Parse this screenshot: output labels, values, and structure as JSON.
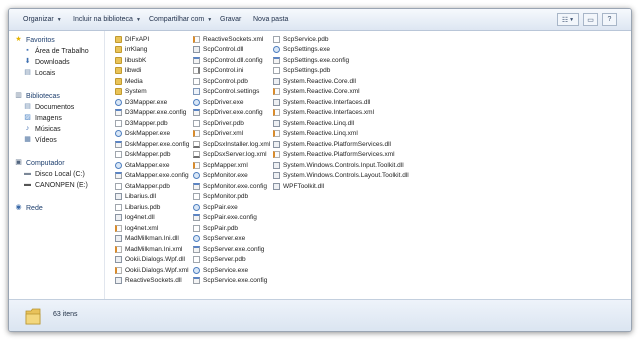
{
  "toolbar": {
    "organize": "Organizar",
    "include": "Incluir na biblioteca",
    "share": "Compartilhar com",
    "burn": "Gravar",
    "new_folder": "Nova pasta"
  },
  "nav": {
    "favorites": "Favoritos",
    "desktop": "Área de Trabalho",
    "downloads": "Downloads",
    "places": "Locais",
    "libraries": "Bibliotecas",
    "documents": "Documentos",
    "pictures": "Imagens",
    "music": "Músicas",
    "videos": "Vídeos",
    "computer": "Computador",
    "local_disk": "Disco Local (C:)",
    "canonpen": "CANONPEN (E:)",
    "network": "Rede"
  },
  "files": {
    "col1": [
      {
        "name": "DIFxAPI",
        "type": "folder"
      },
      {
        "name": "irrKlang",
        "type": "folder"
      },
      {
        "name": "libusbK",
        "type": "folder"
      },
      {
        "name": "libwdi",
        "type": "folder"
      },
      {
        "name": "Media",
        "type": "folder"
      },
      {
        "name": "System",
        "type": "folder"
      },
      {
        "name": "D3Mapper.exe",
        "type": "exe"
      },
      {
        "name": "D3Mapper.exe.config",
        "type": "config"
      },
      {
        "name": "D3Mapper.pdb",
        "type": "pdb"
      },
      {
        "name": "DskMapper.exe",
        "type": "exe"
      },
      {
        "name": "DskMapper.exe.config",
        "type": "config"
      },
      {
        "name": "DskMapper.pdb",
        "type": "pdb"
      },
      {
        "name": "GtaMapper.exe",
        "type": "exe"
      },
      {
        "name": "GtaMapper.exe.config",
        "type": "config"
      },
      {
        "name": "GtaMapper.pdb",
        "type": "pdb"
      },
      {
        "name": "Libarius.dll",
        "type": "dll"
      },
      {
        "name": "Libarius.pdb",
        "type": "pdb"
      },
      {
        "name": "log4net.dll",
        "type": "dll"
      },
      {
        "name": "log4net.xml",
        "type": "xml"
      },
      {
        "name": "MadMilkman.Ini.dll",
        "type": "dll"
      },
      {
        "name": "MadMilkman.Ini.xml",
        "type": "xml"
      },
      {
        "name": "Ookii.Dialogs.Wpf.dll",
        "type": "dll"
      },
      {
        "name": "Ookii.Dialogs.Wpf.xml",
        "type": "xml"
      },
      {
        "name": "ReactiveSockets.dll",
        "type": "dll"
      }
    ],
    "col2": [
      {
        "name": "ReactiveSockets.xml",
        "type": "xml"
      },
      {
        "name": "ScpControl.dll",
        "type": "dll"
      },
      {
        "name": "ScpControl.dll.config",
        "type": "config"
      },
      {
        "name": "ScpControl.ini",
        "type": "ini"
      },
      {
        "name": "ScpControl.pdb",
        "type": "pdb"
      },
      {
        "name": "ScpControl.settings",
        "type": "settings"
      },
      {
        "name": "ScpDriver.exe",
        "type": "exe"
      },
      {
        "name": "ScpDriver.exe.config",
        "type": "config"
      },
      {
        "name": "ScpDriver.pdb",
        "type": "pdb"
      },
      {
        "name": "ScpDriver.xml",
        "type": "xml"
      },
      {
        "name": "ScpDsxInstaller.log.xml",
        "type": "log"
      },
      {
        "name": "ScpDsxServer.log.xml",
        "type": "log"
      },
      {
        "name": "ScpMapper.xml",
        "type": "xml"
      },
      {
        "name": "ScpMonitor.exe",
        "type": "exe"
      },
      {
        "name": "ScpMonitor.exe.config",
        "type": "config"
      },
      {
        "name": "ScpMonitor.pdb",
        "type": "pdb"
      },
      {
        "name": "ScpPair.exe",
        "type": "exe"
      },
      {
        "name": "ScpPair.exe.config",
        "type": "config"
      },
      {
        "name": "ScpPair.pdb",
        "type": "pdb"
      },
      {
        "name": "ScpServer.exe",
        "type": "exe"
      },
      {
        "name": "ScpServer.exe.config",
        "type": "config"
      },
      {
        "name": "ScpServer.pdb",
        "type": "pdb"
      },
      {
        "name": "ScpService.exe",
        "type": "exe"
      },
      {
        "name": "ScpService.exe.config",
        "type": "config"
      }
    ],
    "col3": [
      {
        "name": "ScpService.pdb",
        "type": "pdb"
      },
      {
        "name": "ScpSettings.exe",
        "type": "exe"
      },
      {
        "name": "ScpSettings.exe.config",
        "type": "config"
      },
      {
        "name": "ScpSettings.pdb",
        "type": "pdb"
      },
      {
        "name": "System.Reactive.Core.dll",
        "type": "dll"
      },
      {
        "name": "System.Reactive.Core.xml",
        "type": "xml"
      },
      {
        "name": "System.Reactive.Interfaces.dll",
        "type": "dll"
      },
      {
        "name": "System.Reactive.Interfaces.xml",
        "type": "xml"
      },
      {
        "name": "System.Reactive.Linq.dll",
        "type": "dll"
      },
      {
        "name": "System.Reactive.Linq.xml",
        "type": "xml"
      },
      {
        "name": "System.Reactive.PlatformServices.dll",
        "type": "dll"
      },
      {
        "name": "System.Reactive.PlatformServices.xml",
        "type": "xml"
      },
      {
        "name": "System.Windows.Controls.Input.Toolkit.dll",
        "type": "dll"
      },
      {
        "name": "System.Windows.Controls.Layout.Toolkit.dll",
        "type": "dll"
      },
      {
        "name": "WPFToolkit.dll",
        "type": "dll"
      }
    ]
  },
  "status": {
    "count": "63 itens"
  }
}
